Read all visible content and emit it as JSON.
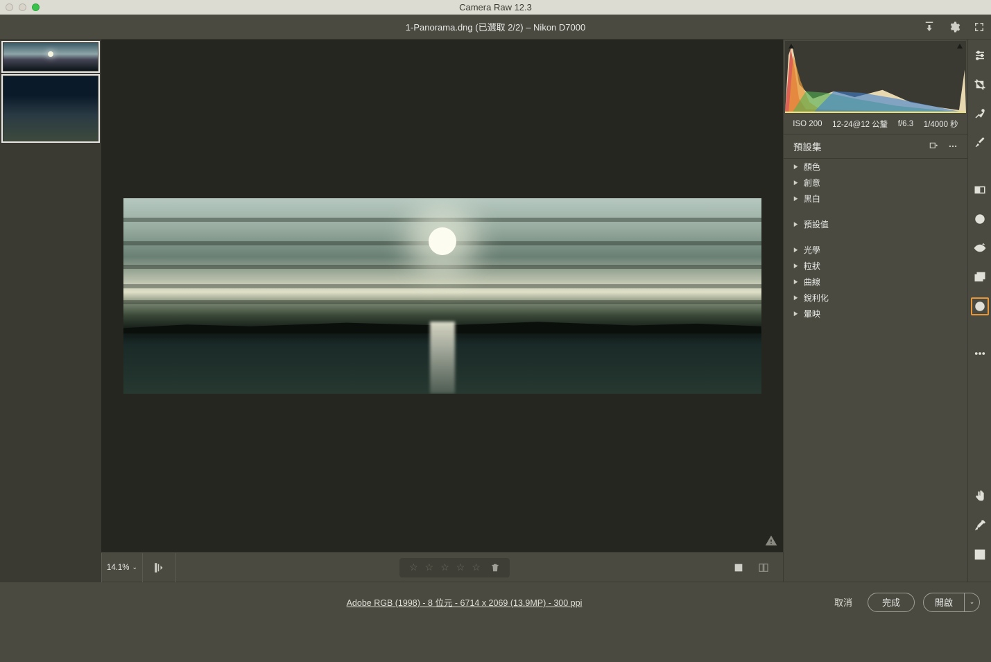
{
  "titlebar": {
    "title": "Camera Raw 12.3"
  },
  "header": {
    "file_title": "1-Panorama.dng (已選取 2/2)  –  Nikon D7000",
    "icons": {
      "export": "export-icon",
      "settings": "gear-icon",
      "fullscreen": "fullscreen-icon"
    }
  },
  "filmstrip": {
    "items": [
      {
        "name": "panorama-thumb",
        "selected": true
      },
      {
        "name": "interior-thumb",
        "selected": true
      }
    ]
  },
  "canvas": {
    "zoom_label": "14.1%"
  },
  "rating": {
    "stars": 5
  },
  "metadata": {
    "iso": "ISO 200",
    "lens": "12-24@12 公釐",
    "aperture": "f/6.3",
    "shutter": "1/4000 秒"
  },
  "panel": {
    "title": "預設集",
    "groups_a": [
      "顏色",
      "創意",
      "黑白"
    ],
    "groups_b": [
      "預設值"
    ],
    "groups_c": [
      "光學",
      "粒狀",
      "曲線",
      "銳利化",
      "暈映"
    ]
  },
  "tool_rail": [
    {
      "name": "edit-sliders-icon",
      "active": false
    },
    {
      "name": "crop-icon",
      "active": false
    },
    {
      "name": "heal-icon",
      "active": false
    },
    {
      "name": "brush-icon",
      "active": false
    },
    {
      "name": "gradient-icon",
      "active": false
    },
    {
      "name": "radial-icon",
      "active": false
    },
    {
      "name": "redeye-icon",
      "active": false
    },
    {
      "name": "snapshots-icon",
      "active": false
    },
    {
      "name": "presets-icon",
      "active": true
    },
    {
      "name": "more-icon",
      "active": false
    }
  ],
  "tool_rail_bottom": [
    {
      "name": "hand-icon"
    },
    {
      "name": "color-sampler-icon"
    },
    {
      "name": "grid-icon"
    }
  ],
  "bottom": {
    "workflow": "Adobe RGB (1998) - 8 位元 - 6714 x 2069 (13.9MP) - 300 ppi",
    "cancel": "取消",
    "done": "完成",
    "open": "開啟"
  }
}
